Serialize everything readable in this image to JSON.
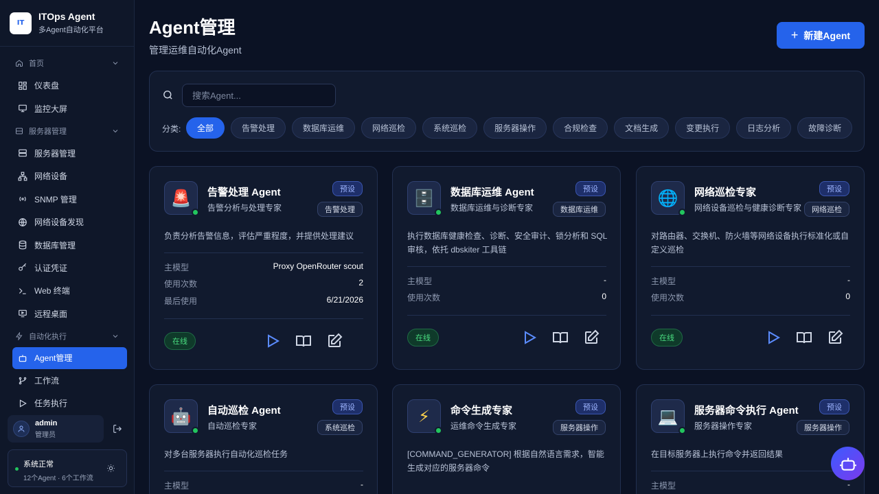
{
  "brand": {
    "logo_text": "IT",
    "title": "ITOps Agent",
    "subtitle": "多Agent自动化平台"
  },
  "sidebar": {
    "groups": [
      {
        "label": "首页",
        "items": [
          "仪表盘",
          "监控大屏"
        ]
      },
      {
        "label": "服务器管理",
        "items": [
          "服务器管理",
          "网络设备",
          "SNMP 管理",
          "网络设备发现",
          "数据库管理",
          "认证凭证",
          "Web 终端",
          "远程桌面"
        ]
      },
      {
        "label": "自动化执行",
        "items": [
          "Agent管理",
          "工作流",
          "任务执行"
        ]
      }
    ],
    "active_item": "Agent管理"
  },
  "user": {
    "name": "admin",
    "role": "管理员"
  },
  "system_status": {
    "title": "系统正常",
    "detail": "12个Agent · 6个工作流"
  },
  "page": {
    "title": "Agent管理",
    "subtitle": "管理运维自动化Agent",
    "new_button": "新建Agent"
  },
  "search": {
    "placeholder": "搜索Agent..."
  },
  "filter": {
    "label": "分类:",
    "categories": [
      "全部",
      "告警处理",
      "数据库运维",
      "网络巡检",
      "系统巡检",
      "服务器操作",
      "合规检查",
      "文档生成",
      "变更执行",
      "日志分析",
      "故障诊断"
    ],
    "active": "全部"
  },
  "labels": {
    "preset": "预设",
    "online": "在线",
    "model": "主模型",
    "usage": "使用次数",
    "last_used": "最后使用"
  },
  "agents": [
    {
      "icon": "🚨",
      "name": "告警处理 Agent",
      "role": "告警分析与处理专家",
      "category": "告警处理",
      "desc": "负责分析告警信息，评估严重程度，并提供处理建议",
      "model": "Proxy OpenRouter scout",
      "usage": "2",
      "last_used": "6/21/2026"
    },
    {
      "icon": "🗄️",
      "name": "数据库运维 Agent",
      "role": "数据库运维与诊断专家",
      "category": "数据库运维",
      "desc": "执行数据库健康检查、诊断、安全审计、锁分析和 SQL 审核，依托 dbskiter 工具链",
      "model": "-",
      "usage": "0"
    },
    {
      "icon": "🌐",
      "name": "网络巡检专家",
      "role": "网络设备巡检与健康诊断专家",
      "category": "网络巡检",
      "desc": "对路由器、交换机、防火墙等网络设备执行标准化或自定义巡检",
      "model": "-",
      "usage": "0"
    },
    {
      "icon": "🤖",
      "name": "自动巡检 Agent",
      "role": "自动巡检专家",
      "category": "系统巡检",
      "desc": "对多台服务器执行自动化巡检任务",
      "model": "-"
    },
    {
      "icon": "⚡",
      "name": "命令生成专家",
      "role": "运维命令生成专家",
      "category": "服务器操作",
      "desc": "[COMMAND_GENERATOR] 根据自然语言需求，智能生成对应的服务器命令"
    },
    {
      "icon": "💻",
      "name": "服务器命令执行 Agent",
      "role": "服务器操作专家",
      "category": "服务器操作",
      "desc": "在目标服务器上执行命令并返回结果",
      "model": "-"
    }
  ]
}
